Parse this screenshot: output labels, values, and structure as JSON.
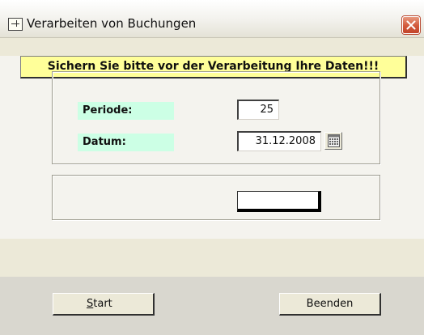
{
  "window": {
    "title": "Verarbeiten von Buchungen",
    "icons": {
      "app": "app-window-icon",
      "close": "close-icon"
    }
  },
  "warning": {
    "text": "Sichern Sie bitte vor der Verarbeitung Ihre Daten!!!",
    "background": "#ffff99"
  },
  "form": {
    "periode": {
      "label": "Periode:",
      "value": "25"
    },
    "datum": {
      "label": "Datum:",
      "value": "31.12.2008",
      "picker_icon": "calendar-icon"
    },
    "label_background": "#ccffe5"
  },
  "buttons": {
    "start": {
      "mnemonic": "S",
      "rest": "tart"
    },
    "beenden": {
      "label": "Beenden"
    }
  },
  "colors": {
    "dialog_background": "#ece9d8",
    "close_button": "#d2583a"
  }
}
